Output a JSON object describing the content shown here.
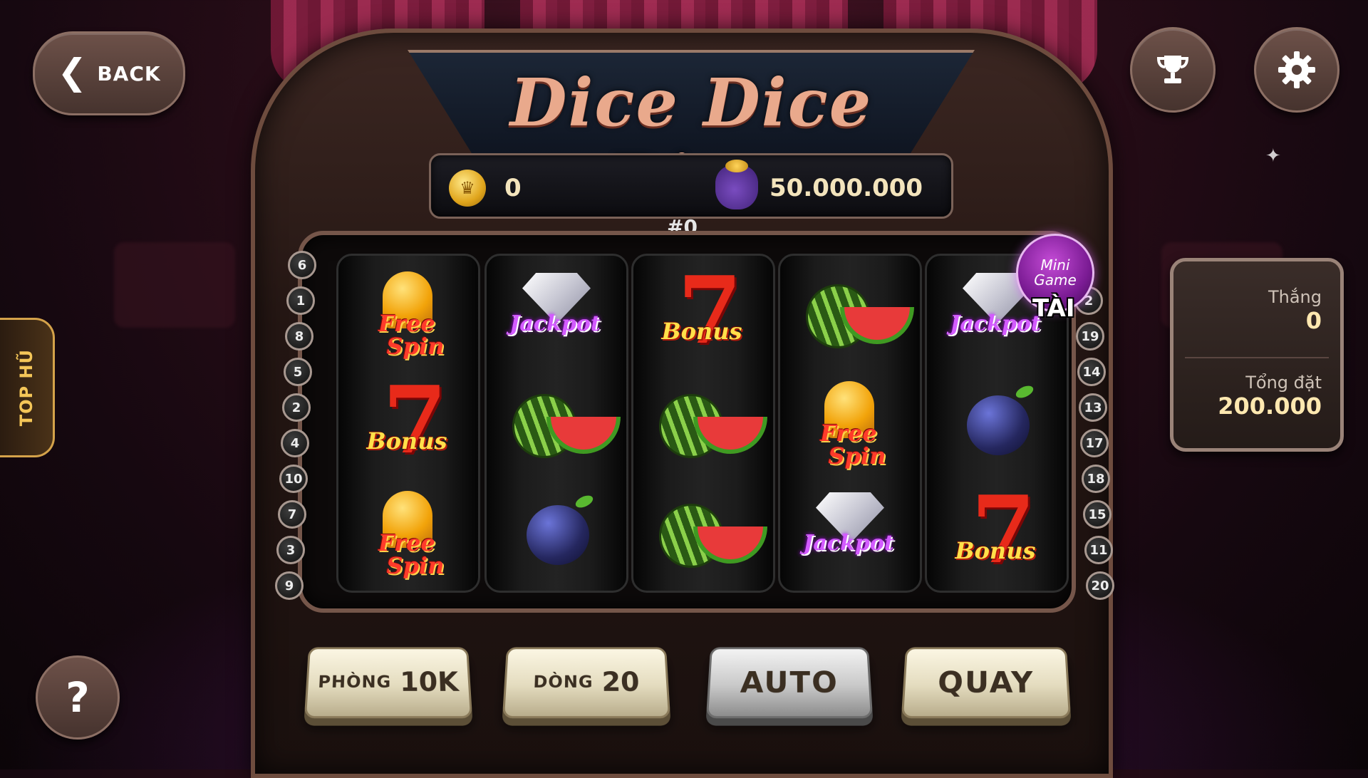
{
  "header": {
    "back_label": "BACK",
    "title": "Dice Dice Dice"
  },
  "icons": {
    "back": "chevron-left-icon",
    "trophy": "trophy-icon",
    "settings": "gear-icon",
    "help": "question-icon",
    "coin": "coin-icon",
    "jackpot_bag": "money-bag-icon"
  },
  "sidebar_tab": {
    "label": "TOP HŨ",
    "arrows": "»"
  },
  "balance": {
    "coins": "0",
    "jackpot": "50.000.000",
    "spin_id": "#0"
  },
  "mini_game": {
    "label_line1": "Mini",
    "label_line2": "Game",
    "result": "TÀI"
  },
  "reels": [
    [
      {
        "type": "freespin",
        "text1": "Free",
        "text2": "Spin"
      },
      {
        "type": "bonus",
        "text1": "Bonus"
      },
      {
        "type": "freespin",
        "text1": "Free",
        "text2": "Spin"
      }
    ],
    [
      {
        "type": "jackpot",
        "text1": "Jackpot"
      },
      {
        "type": "watermelon"
      },
      {
        "type": "plum"
      }
    ],
    [
      {
        "type": "bonus",
        "text1": "Bonus"
      },
      {
        "type": "watermelon"
      },
      {
        "type": "watermelon"
      }
    ],
    [
      {
        "type": "watermelon"
      },
      {
        "type": "freespin",
        "text1": "Free",
        "text2": "Spin"
      },
      {
        "type": "jackpot",
        "text1": "Jackpot"
      }
    ],
    [
      {
        "type": "jackpot",
        "text1": "Jackpot"
      },
      {
        "type": "plum"
      },
      {
        "type": "bonus",
        "text1": "Bonus"
      }
    ]
  ],
  "paylines": {
    "left": [
      "6",
      "1",
      "8",
      "5",
      "2",
      "4",
      "10",
      "7",
      "3",
      "9"
    ],
    "right": [
      "2",
      "19",
      "14",
      "13",
      "17",
      "18",
      "15",
      "11",
      "20"
    ]
  },
  "info_panel": {
    "win_label": "Thắng",
    "win_value": "0",
    "bet_label": "Tổng đặt",
    "bet_value": "200.000"
  },
  "controls": {
    "room_label": "PHÒNG",
    "room_value": "10K",
    "lines_label": "DÒNG",
    "lines_value": "20",
    "auto_label": "AUTO",
    "spin_label": "QUAY"
  }
}
